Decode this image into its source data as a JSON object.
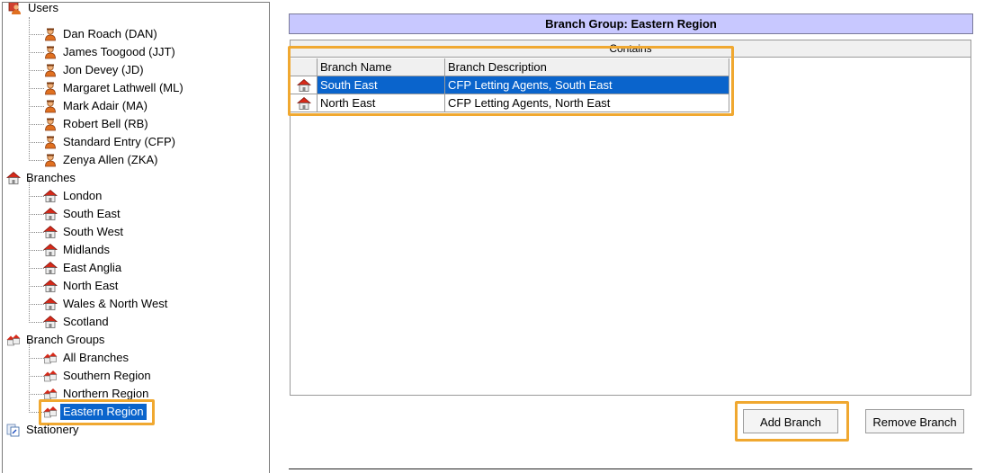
{
  "tree": {
    "users": {
      "label": "Users",
      "items": [
        "Dan Roach  (DAN)",
        "James Toogood  (JJT)",
        "Jon Devey  (JD)",
        "Margaret Lathwell  (ML)",
        "Mark Adair  (MA)",
        "Robert Bell  (RB)",
        "Standard Entry  (CFP)",
        "Zenya Allen  (ZKA)"
      ]
    },
    "branches": {
      "label": "Branches",
      "items": [
        "London",
        "South East",
        "South West",
        "Midlands",
        "East Anglia",
        "North East",
        "Wales & North West",
        "Scotland"
      ]
    },
    "branch_groups": {
      "label": "Branch Groups",
      "items": [
        "All Branches",
        "Southern Region",
        "Northern Region",
        "Eastern Region"
      ],
      "selected": "Eastern Region"
    },
    "stationery": {
      "label": "Stationery"
    }
  },
  "main": {
    "title": "Branch Group: Eastern Region",
    "contains_label": "Contains",
    "columns": [
      "Branch Name",
      "Branch Description"
    ],
    "rows": [
      {
        "name": "South East",
        "description": "CFP Letting Agents, South East",
        "selected": true
      },
      {
        "name": "North East",
        "description": "CFP Letting Agents, North East",
        "selected": false
      }
    ],
    "add_button": "Add Branch",
    "remove_button": "Remove Branch"
  },
  "colors": {
    "selection": "#0a64cc",
    "title_bar": "#c8c8ff",
    "highlight": "#f0a830"
  },
  "icons": {
    "user": "user-icon",
    "branch": "branch-house-icon",
    "branch_group": "branch-group-icon",
    "stationery": "stationery-icon"
  }
}
